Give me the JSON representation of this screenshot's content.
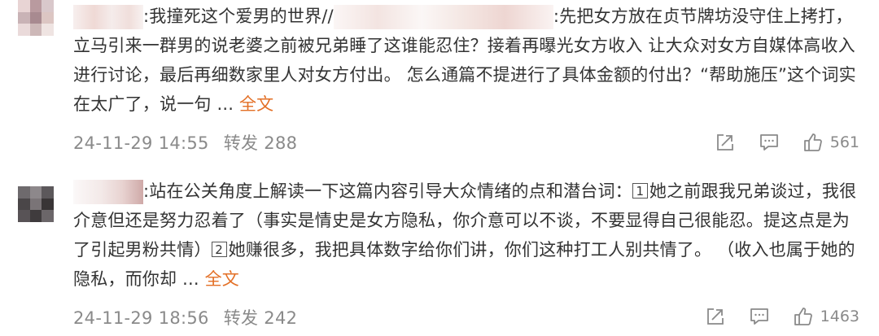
{
  "comments": [
    {
      "name_prefix": ":",
      "text_part1": "我撞死这个爱男的世界//",
      "text_part2": ":先把女方放在贞节牌坊没守住上拷打，立马引来一群男的说老婆之前被兄弟睡了这谁能忍住？接着再曝光女方收入 让大众对女方自媒体高收入进行讨论，最后再细数家里人对女方付出。 怎么通篇不提进行了具体金额的付出？“帮助施压”这个词实在太广了，说一句 ... ",
      "more_label": "全文",
      "time": "24-11-29 14:55",
      "repost_label": "转发 288",
      "like_count": "561",
      "icons": {
        "share": "share-icon",
        "comment": "comment-icon",
        "like": "thumbs-up-icon"
      }
    },
    {
      "name_prefix": ":",
      "text_part1": "站在公关角度上解读一下这篇内容引导大众情绪的点和潜台词：",
      "num1": "1",
      "text_part2": "她之前跟我兄弟谈过，我很介意但还是努力忍着了（事实是情史是女方隐私，你介意可以不谈，不要显得自己很能忍。提这点是为了引起男粉共情）",
      "num2": "2",
      "text_part3": "她赚很多，我把具体数字给你们讲，你们这种打工人别共情了。 （收入也属于她的隐私，而你却 ... ",
      "more_label": "全文",
      "time": "24-11-29 18:56",
      "repost_label": "转发 242",
      "like_count": "1463",
      "icons": {
        "share": "share-icon",
        "comment": "comment-icon",
        "like": "thumbs-up-icon"
      }
    }
  ],
  "colors": {
    "text": "#333333",
    "meta": "#8a8a8a",
    "link": "#e36f25"
  }
}
